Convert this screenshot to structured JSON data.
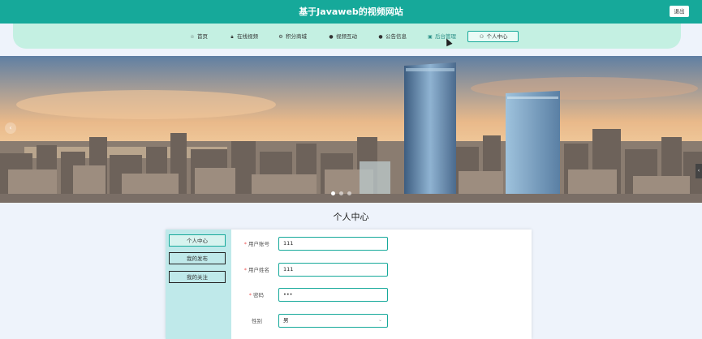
{
  "header": {
    "title": "基于Javaweb的视频网站",
    "logout_label": "退出"
  },
  "nav": {
    "items": [
      {
        "label": "首页",
        "icon": "star-icon"
      },
      {
        "label": "在线视频",
        "icon": "lock-icon"
      },
      {
        "label": "积分商城",
        "icon": "gear-icon"
      },
      {
        "label": "视频互动",
        "icon": "question-icon"
      },
      {
        "label": "公告信息",
        "icon": "info-icon"
      },
      {
        "label": "后台管理",
        "icon": "briefcase-icon"
      },
      {
        "label": "个人中心",
        "icon": "user-icon"
      }
    ],
    "active": "个人中心"
  },
  "banner": {
    "slide_count": 3,
    "current_slide": 1
  },
  "profile": {
    "heading": "个人中心",
    "menu": [
      {
        "label": "个人中心"
      },
      {
        "label": "我的发布"
      },
      {
        "label": "我的关注"
      }
    ],
    "fields": [
      {
        "label": "用户账号",
        "required": "*",
        "value": "111"
      },
      {
        "label": "用户姓名",
        "required": "*",
        "value": "111"
      },
      {
        "label": "密码",
        "required": "*",
        "value": "•••"
      },
      {
        "label": "性别",
        "required": "",
        "value": "男"
      }
    ]
  },
  "colors": {
    "primary": "#16a99a",
    "nav_band": "#c4f0e2",
    "side_menu": "#bfe9ea",
    "page_bg": "#eef3fb"
  }
}
